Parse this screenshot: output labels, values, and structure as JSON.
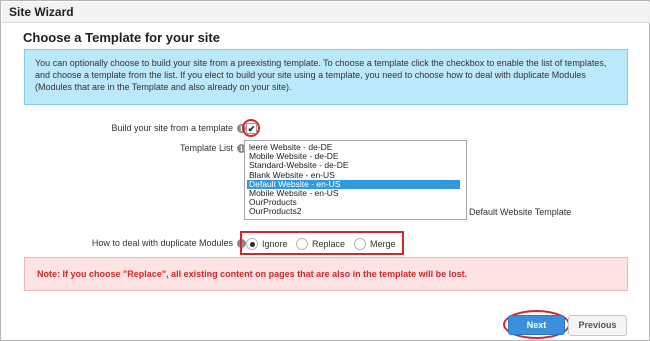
{
  "window": {
    "title": "Site Wizard"
  },
  "page": {
    "heading": "Choose a Template for your site",
    "info_text": "You can optionally choose to build your site from a preexisting template. To choose a template click the checkbox to enable the list of templates, and choose a template from the list. If you elect to build your site using a template, you need to choose how to deal with duplicate Modules (Modules that are in the Template and also already on your site)."
  },
  "form": {
    "build_from_template": {
      "label": "Build your site from a template",
      "checked": true,
      "check_glyph": "✔"
    },
    "template_list": {
      "label": "Template List",
      "options": [
        "leere Website - de-DE",
        "Mobile Website - de-DE",
        "Standard-Website - de-DE",
        "Blank Website - en-US",
        "Default Website - en-US",
        "Mobile Website - en-US",
        "OurProducts",
        "OurProducts2"
      ],
      "selected": "Default Website - en-US",
      "selected_description": "Default Website Template"
    },
    "duplicate_modules": {
      "label": "How to deal with duplicate Modules",
      "options": [
        "Ignore",
        "Replace",
        "Merge"
      ],
      "selected": "Ignore"
    },
    "info_icon_glyph": "i"
  },
  "warning": {
    "text": "Note: If you choose \"Replace\", all existing content on pages that are also in the template will be lost."
  },
  "buttons": {
    "next": "Next",
    "previous": "Previous"
  },
  "colors": {
    "accent": "#3a8fdc",
    "info_bg": "#bce8fb",
    "warning_bg": "#fde3e3",
    "warning_text": "#d9252a",
    "highlight": "#d8242c"
  }
}
